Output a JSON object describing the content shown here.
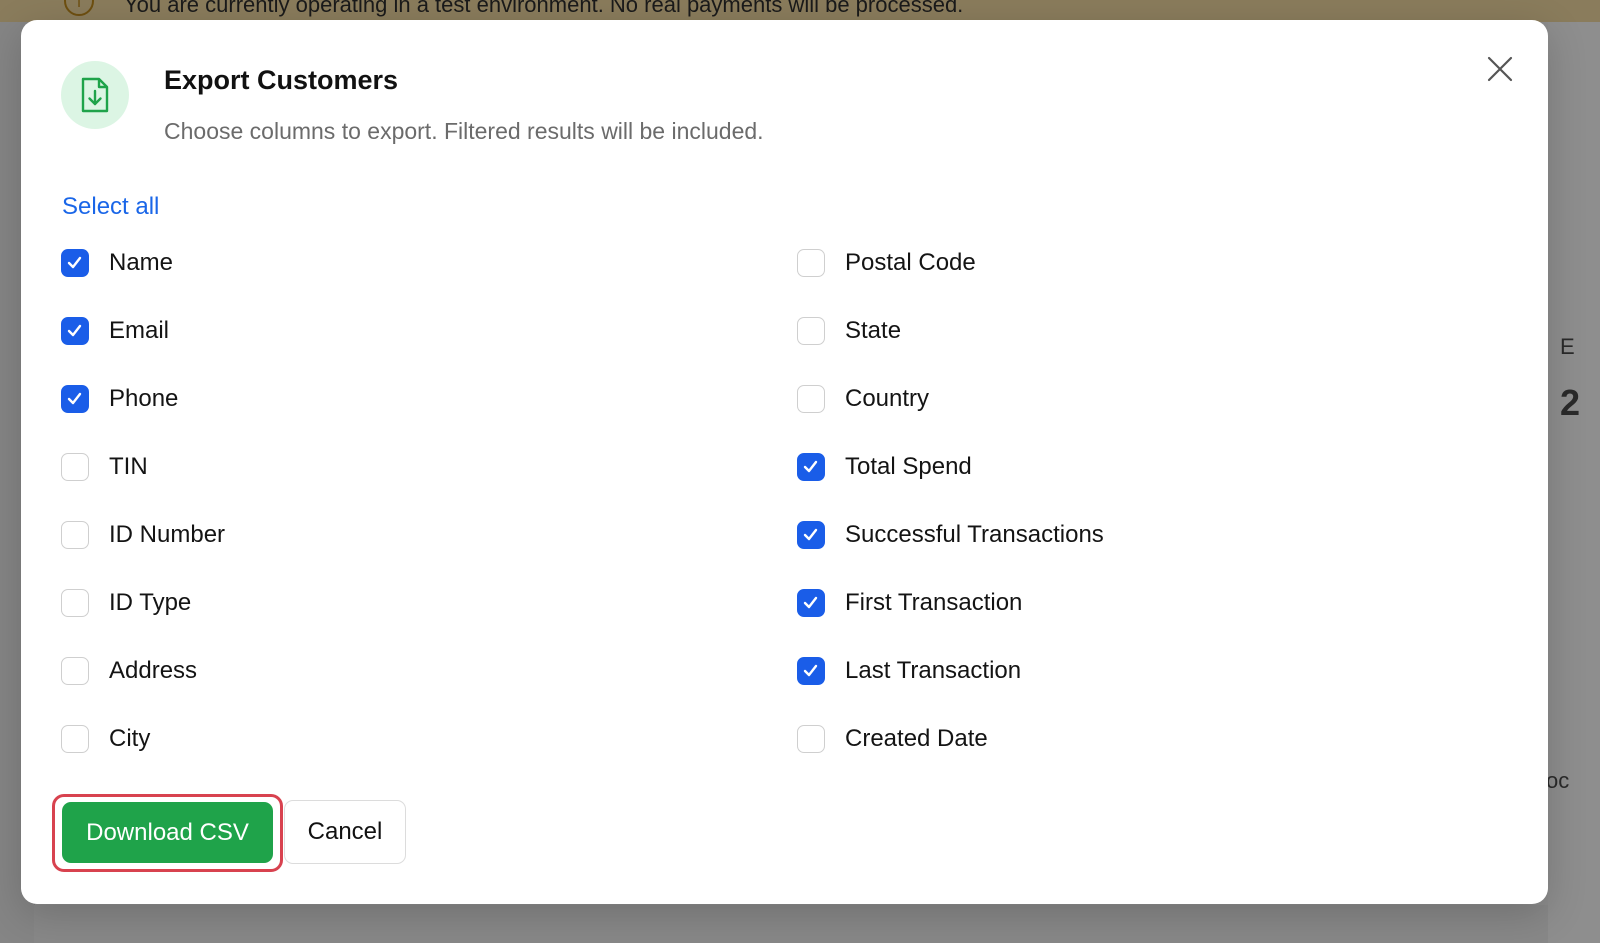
{
  "background": {
    "banner_text": "You are currently operating in a test environment. No real payments will be processed.",
    "banner_icon": "info-icon",
    "right_fragments": [
      "E",
      "2",
      "oc"
    ]
  },
  "modal": {
    "header_icon": "file-download-icon",
    "title": "Export Customers",
    "subtitle": "Choose columns to export. Filtered results will be included.",
    "close_icon": "close-icon",
    "select_all_label": "Select all",
    "columns_left": [
      {
        "label": "Name",
        "checked": true
      },
      {
        "label": "Email",
        "checked": true
      },
      {
        "label": "Phone",
        "checked": true
      },
      {
        "label": "TIN",
        "checked": false
      },
      {
        "label": "ID Number",
        "checked": false
      },
      {
        "label": "ID Type",
        "checked": false
      },
      {
        "label": "Address",
        "checked": false
      },
      {
        "label": "City",
        "checked": false
      }
    ],
    "columns_right": [
      {
        "label": "Postal Code",
        "checked": false
      },
      {
        "label": "State",
        "checked": false
      },
      {
        "label": "Country",
        "checked": false
      },
      {
        "label": "Total Spend",
        "checked": true
      },
      {
        "label": "Successful Transactions",
        "checked": true
      },
      {
        "label": "First Transaction",
        "checked": true
      },
      {
        "label": "Last Transaction",
        "checked": true
      },
      {
        "label": "Created Date",
        "checked": false
      }
    ],
    "download_label": "Download CSV",
    "cancel_label": "Cancel"
  },
  "colors": {
    "accent_green": "#1fa34a",
    "checkbox_blue": "#1a5de8",
    "link_blue": "#1a66e8",
    "highlight_red": "#d8424f",
    "icon_bg": "#dcf5e4"
  }
}
